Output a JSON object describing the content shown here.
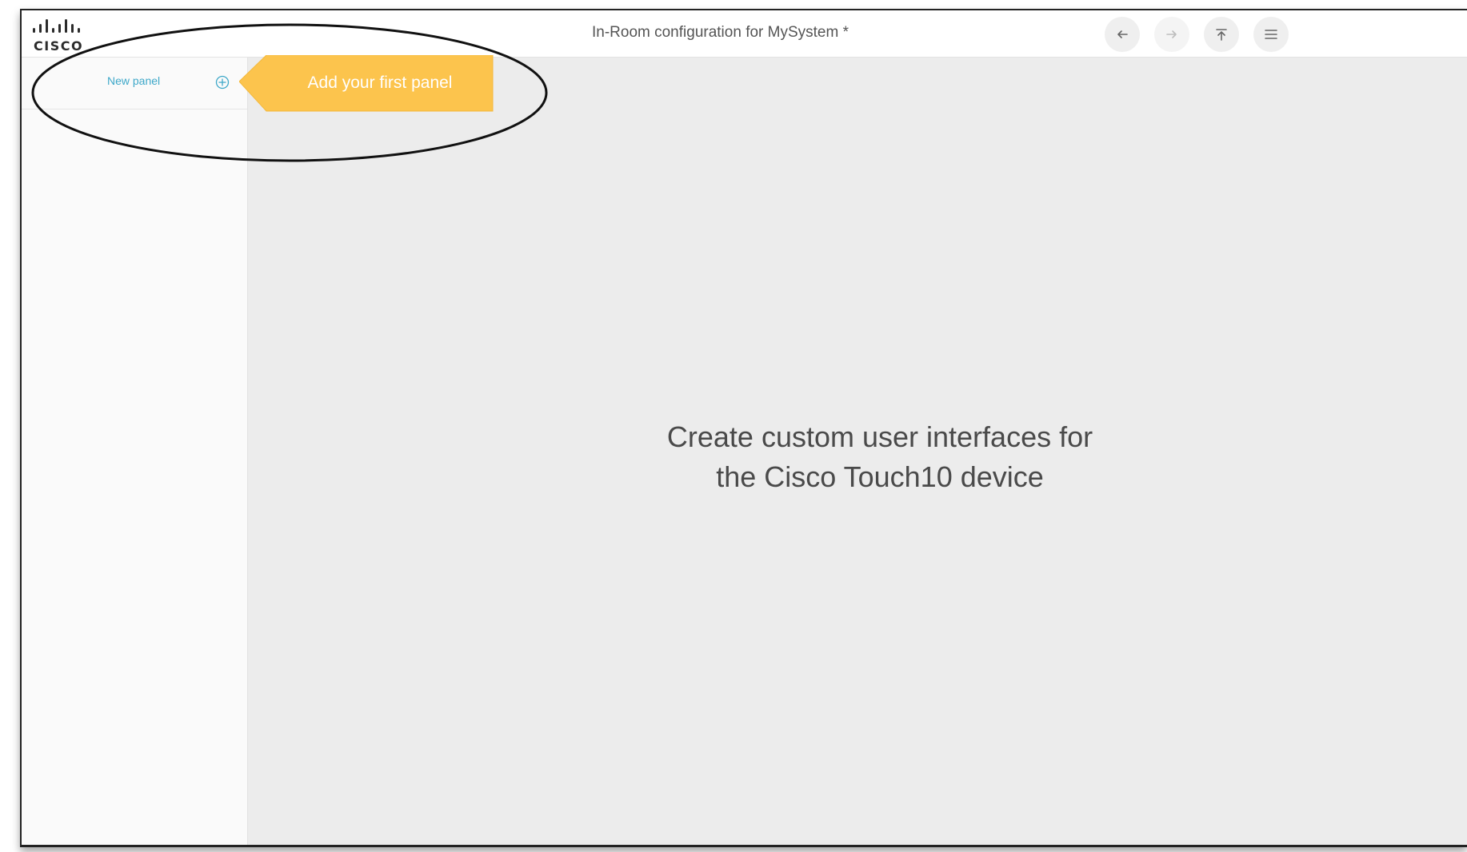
{
  "header": {
    "logo_text": "CISCO",
    "title": "In-Room configuration for MySystem *",
    "buttons": [
      {
        "icon": "undo-icon",
        "label": ""
      },
      {
        "icon": "redo-icon",
        "label": ""
      },
      {
        "icon": "upload-icon",
        "label": ""
      },
      {
        "icon": "menu-icon",
        "label": ""
      }
    ]
  },
  "sidebar": {
    "new_panel_label": "New panel",
    "add_icon": "plus-circle-icon"
  },
  "tooltip": {
    "text": "Add your first panel",
    "color": "#fcc44d"
  },
  "canvas": {
    "line1": "Create custom user interfaces for",
    "line2": "the Cisco Touch10 device"
  },
  "colors": {
    "accent": "#3ea8c9",
    "canvas_bg": "#ececec",
    "sidebar_bg": "#fafafa"
  }
}
